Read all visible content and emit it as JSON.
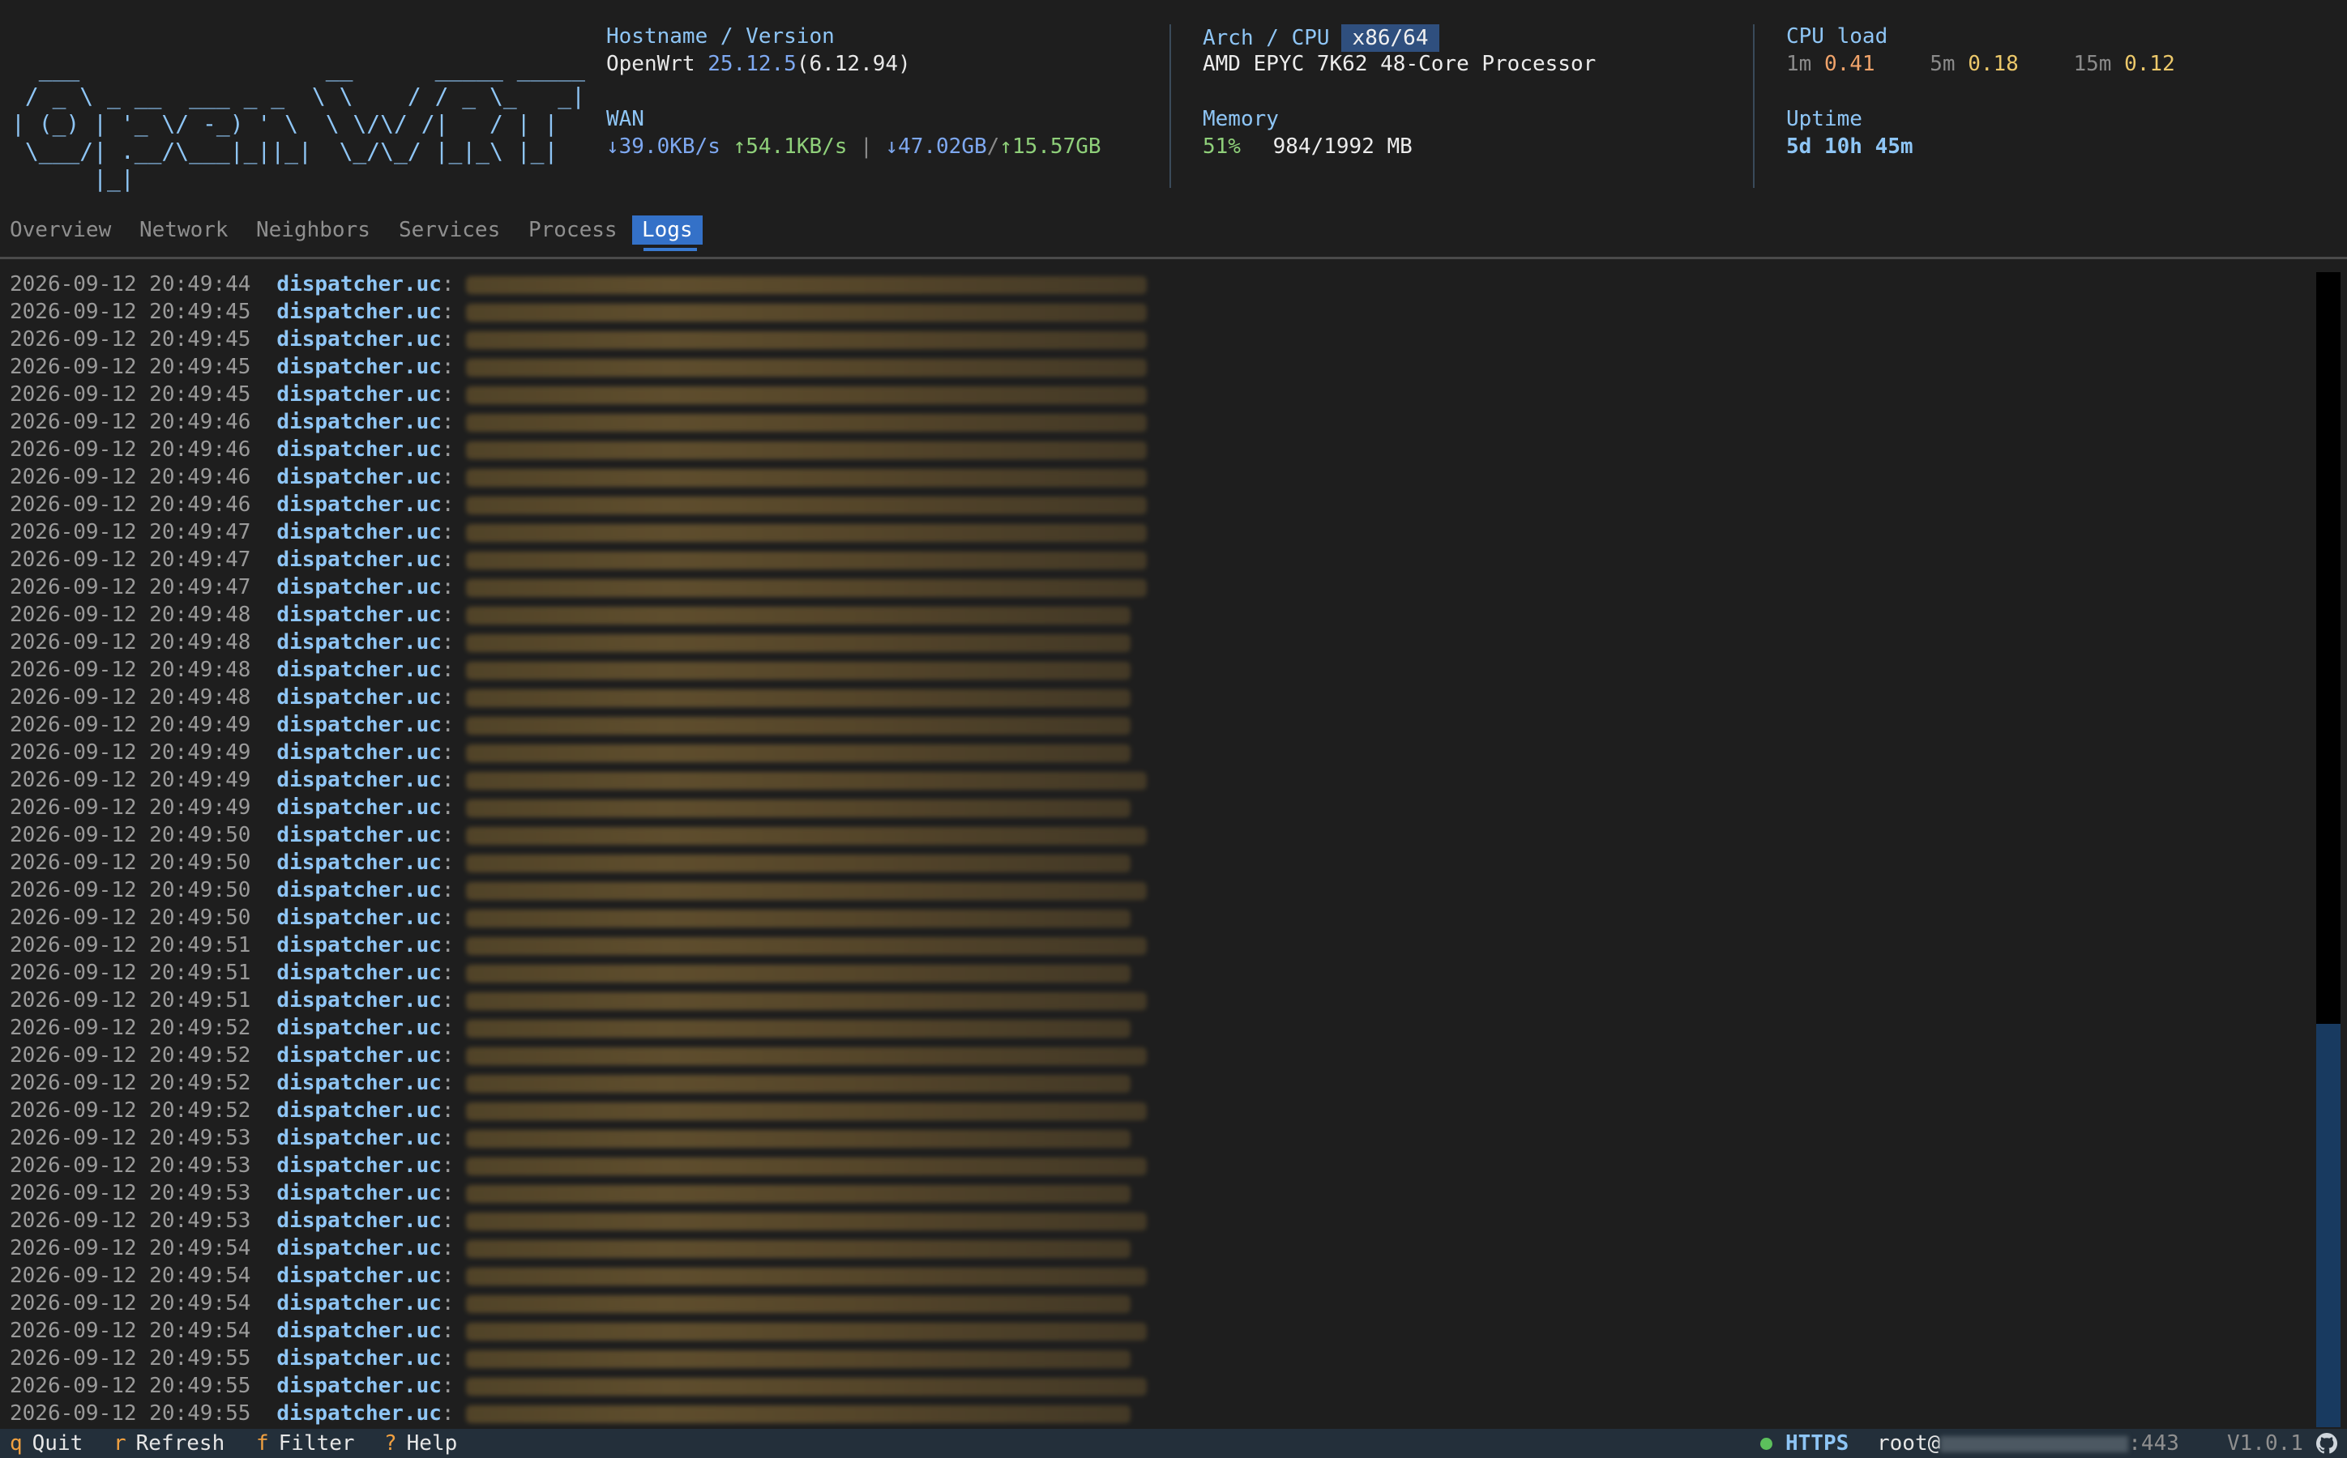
{
  "logo": {
    "ascii": "  ___                  __      _____ _____ \n / _ \\ _ __  ___ _ _  \\ \\    / / _ \\_   _|\n| (_) | '_ \\/ -_) ' \\  \\ \\/\\/ /|   / | |  \n \\___/| .__/\\___|_||_|  \\_/\\_/ |_|_\\ |_|  \n      |_|                                 "
  },
  "system": {
    "hostname_label": "Hostname / Version",
    "os_name": "OpenWrt",
    "os_version": "25.12.5",
    "kernel": "(6.12.94)",
    "wan_label": "WAN",
    "wan_down_rate": "↓39.0KB/s",
    "wan_up_rate": "↑54.1KB/s",
    "wan_divider": "|",
    "wan_down_total": "↓47.02GB",
    "wan_slash": "/",
    "wan_up_total": "↑15.57GB",
    "arch_label": "Arch / CPU",
    "arch": "x86/64",
    "cpu_model": "AMD EPYC 7K62 48-Core Processor",
    "memory_label": "Memory",
    "memory_percent": "51%",
    "memory_usage": "984/1992 MB",
    "cpu_load_label": "CPU load",
    "load_1m_label": "1m",
    "load_1m": "0.41",
    "load_5m_label": "5m",
    "load_5m": "0.18",
    "load_15m_label": "15m",
    "load_15m": "0.12",
    "uptime_label": "Uptime",
    "uptime": "5d 10h 45m"
  },
  "tabs": [
    {
      "label": "Overview",
      "active": false
    },
    {
      "label": "Network",
      "active": false
    },
    {
      "label": "Neighbors",
      "active": false
    },
    {
      "label": "Services",
      "active": false
    },
    {
      "label": "Process",
      "active": false
    },
    {
      "label": "Logs",
      "active": true
    }
  ],
  "logs": {
    "source": "dispatcher.uc",
    "entries": [
      "2026-09-12 20:49:44",
      "2026-09-12 20:49:45",
      "2026-09-12 20:49:45",
      "2026-09-12 20:49:45",
      "2026-09-12 20:49:45",
      "2026-09-12 20:49:46",
      "2026-09-12 20:49:46",
      "2026-09-12 20:49:46",
      "2026-09-12 20:49:46",
      "2026-09-12 20:49:47",
      "2026-09-12 20:49:47",
      "2026-09-12 20:49:47",
      "2026-09-12 20:49:48",
      "2026-09-12 20:49:48",
      "2026-09-12 20:49:48",
      "2026-09-12 20:49:48",
      "2026-09-12 20:49:49",
      "2026-09-12 20:49:49",
      "2026-09-12 20:49:49",
      "2026-09-12 20:49:49",
      "2026-09-12 20:49:50",
      "2026-09-12 20:49:50",
      "2026-09-12 20:49:50",
      "2026-09-12 20:49:50",
      "2026-09-12 20:49:51",
      "2026-09-12 20:49:51",
      "2026-09-12 20:49:51",
      "2026-09-12 20:49:52",
      "2026-09-12 20:49:52",
      "2026-09-12 20:49:52",
      "2026-09-12 20:49:52",
      "2026-09-12 20:49:53",
      "2026-09-12 20:49:53",
      "2026-09-12 20:49:53",
      "2026-09-12 20:49:53",
      "2026-09-12 20:49:54",
      "2026-09-12 20:49:54",
      "2026-09-12 20:49:54",
      "2026-09-12 20:49:54",
      "2026-09-12 20:49:55",
      "2026-09-12 20:49:55",
      "2026-09-12 20:49:55"
    ]
  },
  "statusbar": {
    "keys": [
      {
        "key": "q",
        "label": "Quit"
      },
      {
        "key": "r",
        "label": "Refresh"
      },
      {
        "key": "f",
        "label": "Filter"
      },
      {
        "key": "?",
        "label": "Help"
      }
    ],
    "protocol": "HTTPS",
    "user": "root@",
    "port": ":443",
    "version": "V1.0.1"
  },
  "icons": {
    "connection": "status-dot-icon",
    "repo": "github-icon"
  }
}
